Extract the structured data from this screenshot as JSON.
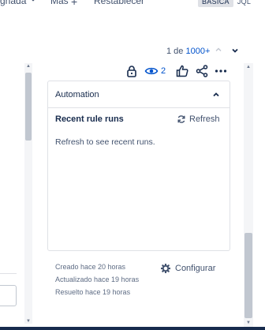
{
  "toolbar": {
    "assigned_label": "gnada",
    "more_label": "Más",
    "reset_label": "Restablecer",
    "mode_basic": "BÁSICA",
    "mode_jql": "JQL"
  },
  "pager": {
    "prefix": "1 de",
    "total": "1000+"
  },
  "actions": {
    "watch_count": "2"
  },
  "automation": {
    "title": "Automation",
    "runs_title": "Recent rule runs",
    "refresh_label": "Refresh",
    "empty_text": "Refresh to see recent runs."
  },
  "meta": {
    "created": "Creado hace 20 horas",
    "updated": "Actualizado hace 19 horas",
    "resolved": "Resuelto hace 19 horas",
    "configure_label": "Configurar"
  },
  "icons": {
    "chevron": "chevron-down-icon",
    "plus": "plus-icon",
    "lock": "lock-icon",
    "eye": "eye-icon",
    "like": "thumbs-up-icon",
    "share": "share-icon",
    "more": "more-icon",
    "refresh": "refresh-icon",
    "gear": "gear-icon"
  },
  "colors": {
    "link": "#0052cc",
    "text": "#172b4d",
    "muted": "#42526e",
    "border": "#dfe1e6"
  }
}
